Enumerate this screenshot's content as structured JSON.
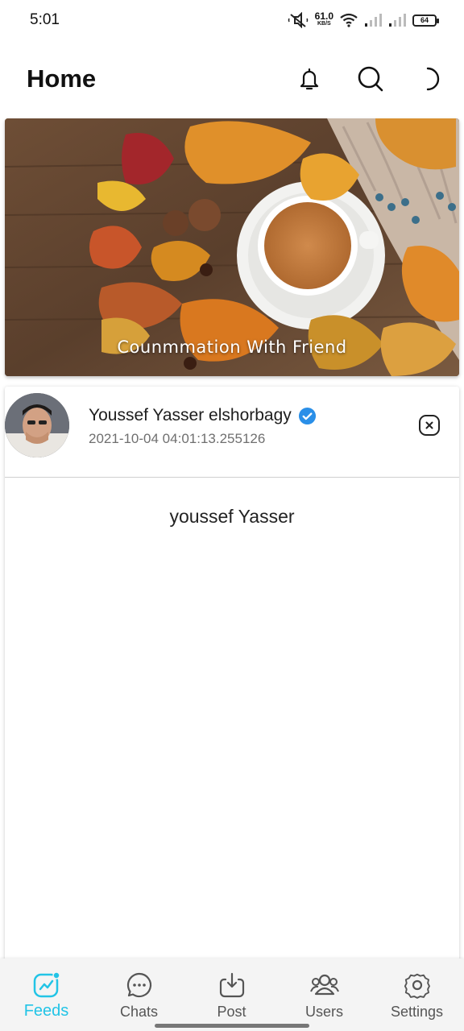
{
  "status": {
    "time": "5:01",
    "net_speed_value": "61.0",
    "net_speed_unit": "KB/S",
    "battery": "64",
    "icons": [
      "mute-icon",
      "wifi-icon",
      "signal-icon",
      "signal-icon",
      "battery-icon"
    ]
  },
  "header": {
    "title": "Home",
    "actions": [
      "bell-icon",
      "search-icon",
      "moon-icon"
    ]
  },
  "banner": {
    "caption": "Counmmation With Friend"
  },
  "post": {
    "author": "Youssef Yasser elshorbagy",
    "verified": true,
    "date": "2021-10-04 04:01:13.255126",
    "text": "youssef Yasser"
  },
  "nav": {
    "items": [
      {
        "label": "Feeds",
        "icon": "feeds-icon",
        "active": true
      },
      {
        "label": "Chats",
        "icon": "chat-icon",
        "active": false
      },
      {
        "label": "Post",
        "icon": "post-upload-icon",
        "active": false
      },
      {
        "label": "Users",
        "icon": "users-icon",
        "active": false
      },
      {
        "label": "Settings",
        "icon": "gear-icon",
        "active": false
      }
    ]
  },
  "colors": {
    "accent": "#22c4e6",
    "verified": "#2a8fe8"
  }
}
